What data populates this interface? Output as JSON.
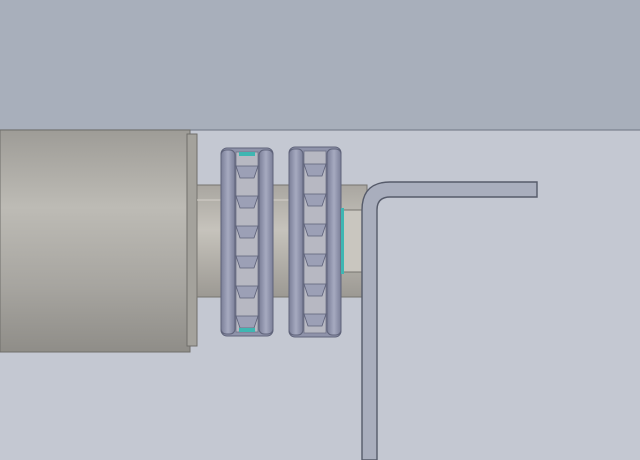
{
  "scene": {
    "background_color": "#c4c8d2",
    "upper_plate_color": "#a8afbb",
    "roller_color": "#b3b2ad",
    "shaft_color": "#b9b6ae",
    "chain_color": "#8a8ea6",
    "bracket_color": "#9aa0b0",
    "highlight_color": "#3fb6b2"
  },
  "parts": {
    "upper_plate": "plate",
    "roller": "roller",
    "shaft": "shaft",
    "sprocket_left": "sprocket",
    "sprocket_right": "sprocket",
    "bracket": "bracket"
  }
}
